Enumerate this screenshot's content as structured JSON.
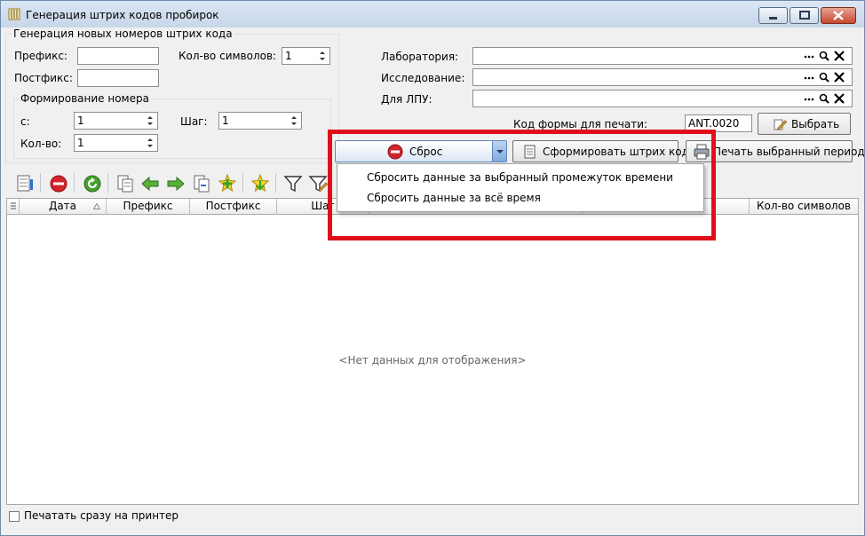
{
  "window": {
    "title": "Генерация штрих кодов пробирок"
  },
  "generation": {
    "group_title": "Генерация новых номеров штрих кода",
    "prefix_label": "Префикс:",
    "prefix_value": "",
    "postfix_label": "Постфикс:",
    "postfix_value": "",
    "symbols_label": "Кол-во символов:",
    "symbols_value": "1"
  },
  "numbering": {
    "group_title": "Формирование номера",
    "from_label": "с:",
    "from_value": "1",
    "step_label": "Шаг:",
    "step_value": "1",
    "count_label": "Кол-во:",
    "count_value": "1"
  },
  "lookups": {
    "lab_label": "Лаборатория:",
    "lab_value": "",
    "research_label": "Исследование:",
    "research_value": "",
    "lpu_label": "Для ЛПУ:",
    "lpu_value": "",
    "print_form_label": "Код формы для печати:",
    "print_form_value": "ANT.0020",
    "select_button": "Выбрать"
  },
  "actions": {
    "reset_button": "Сброс",
    "generate_button": "Сформировать штрих код",
    "print_period_button": "Печать выбранный период"
  },
  "reset_menu": {
    "items": [
      "Сбросить данные за выбранный промежуток времени",
      "Сбросить данные за всё время"
    ]
  },
  "grid": {
    "columns": [
      "Дата",
      "Префикс",
      "Постфикс",
      "Шаг",
      "Кол-во символов"
    ],
    "empty_text": "<Нет данных для отображения>"
  },
  "footer": {
    "print_immediately_label": "Печатать сразу на принтер"
  },
  "colors": {
    "highlight": "#e0101a",
    "title_bar": "#c7d6ea",
    "window_bg": "#f0f0f0"
  }
}
